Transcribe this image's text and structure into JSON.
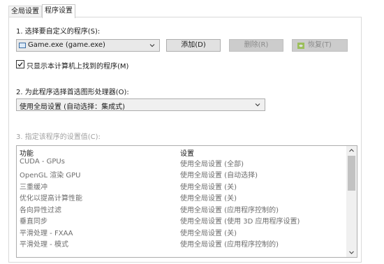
{
  "tabs": [
    "全局设置",
    "程序设置"
  ],
  "section1": {
    "label": "1. 选择要自定义的程序(S):",
    "program_selected": "Game.exe (game.exe)",
    "add_button": "添加(D)",
    "remove_button": "删除(R)",
    "restore_button": "恢复(T)",
    "checkbox_label": "只显示本计算机上找到的程序(M)",
    "checkbox_checked": true
  },
  "section2": {
    "label": "2. 为此程序选择首选图形处理器(O):",
    "gpu_selected": "使用全局设置 (自动选择：集成式)"
  },
  "section3": {
    "label": "3. 指定该程序的设置值(C):",
    "columns": [
      "功能",
      "设置"
    ],
    "rows": [
      {
        "feature": "CUDA - GPUs",
        "setting": "使用全局设置 (全部)"
      },
      {
        "feature": "OpenGL 渲染 GPU",
        "setting": "使用全局设置 (自动选择)"
      },
      {
        "feature": "三重缓冲",
        "setting": "使用全局设置 (关)"
      },
      {
        "feature": "优化以提高计算性能",
        "setting": "使用全局设置 (关)"
      },
      {
        "feature": "各向异性过滤",
        "setting": "使用全局设置 (应用程序控制的)"
      },
      {
        "feature": "垂直同步",
        "setting": "使用全局设置 (使用 3D 应用程序设置)"
      },
      {
        "feature": "平滑处理 - FXAA",
        "setting": "使用全局设置 (关)"
      },
      {
        "feature": "平滑处理 - 模式",
        "setting": "使用全局设置 (应用程序控制的)"
      }
    ]
  },
  "colors": {
    "nvidia_green": "#76b900",
    "disabled_text": "#8a8a8a",
    "button_bg": "#e1e1e1"
  }
}
